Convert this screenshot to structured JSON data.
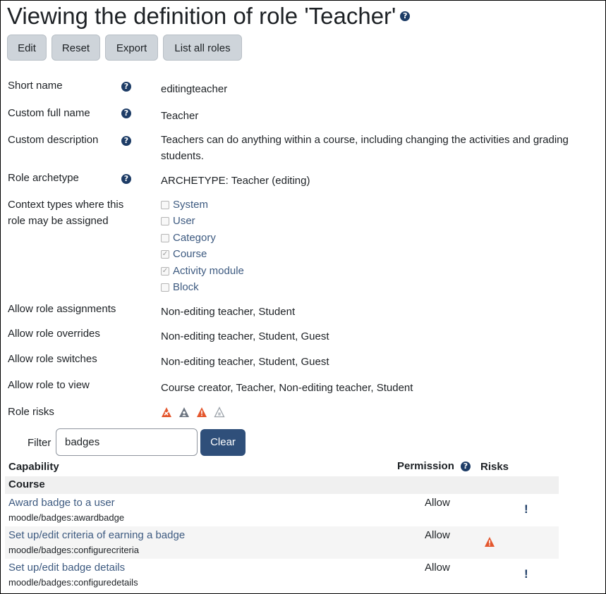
{
  "title": "Viewing the definition of role 'Teacher'",
  "buttons": {
    "edit": "Edit",
    "reset": "Reset",
    "export": "Export",
    "list_all": "List all roles"
  },
  "fields": {
    "short_name": {
      "label": "Short name",
      "value": "editingteacher"
    },
    "custom_full_name": {
      "label": "Custom full name",
      "value": "Teacher"
    },
    "custom_description": {
      "label": "Custom description",
      "value_line1": "Teachers can do anything within a course, including changing the activities and grading",
      "value_line2": "students."
    },
    "role_archetype": {
      "label": "Role archetype",
      "value": "ARCHETYPE: Teacher (editing)"
    },
    "context_types": {
      "label_line1": "Context types where this",
      "label_line2": "role may be assigned",
      "options": [
        {
          "label": "System",
          "checked": false
        },
        {
          "label": "User",
          "checked": false
        },
        {
          "label": "Category",
          "checked": false
        },
        {
          "label": "Course",
          "checked": true
        },
        {
          "label": "Activity module",
          "checked": true
        },
        {
          "label": "Block",
          "checked": false
        }
      ]
    },
    "allow_assignments": {
      "label": "Allow role assignments",
      "value": "Non-editing teacher, Student"
    },
    "allow_overrides": {
      "label": "Allow role overrides",
      "value": "Non-editing teacher, Student, Guest"
    },
    "allow_switches": {
      "label": "Allow role switches",
      "value": "Non-editing teacher, Student, Guest"
    },
    "allow_view": {
      "label": "Allow role to view",
      "value": "Course creator, Teacher, Non-editing teacher, Student"
    },
    "role_risks": {
      "label": "Role risks",
      "icons": [
        "risk-xss-icon",
        "risk-personal-icon",
        "risk-config-icon",
        "risk-dataloss-icon"
      ]
    }
  },
  "filter": {
    "label": "Filter",
    "value": "badges",
    "clear": "Clear"
  },
  "table": {
    "headers": {
      "capability": "Capability",
      "permission": "Permission",
      "risks": "Risks"
    },
    "section": "Course",
    "rows": [
      {
        "name": "Award badge to a user",
        "code": "moodle/badges:awardbadge",
        "permission": "Allow",
        "risk": "exclamation-icon"
      },
      {
        "name": "Set up/edit criteria of earning a badge",
        "code": "moodle/badges:configurecriteria",
        "permission": "Allow",
        "risk": "risk-config-icon"
      },
      {
        "name": "Set up/edit badge details",
        "code": "moodle/badges:configuredetails",
        "permission": "Allow",
        "risk": "exclamation-icon"
      }
    ]
  },
  "colors": {
    "link": "#3d5a80",
    "primary_button": "#2f4f7a",
    "risk": "#e4572e"
  }
}
